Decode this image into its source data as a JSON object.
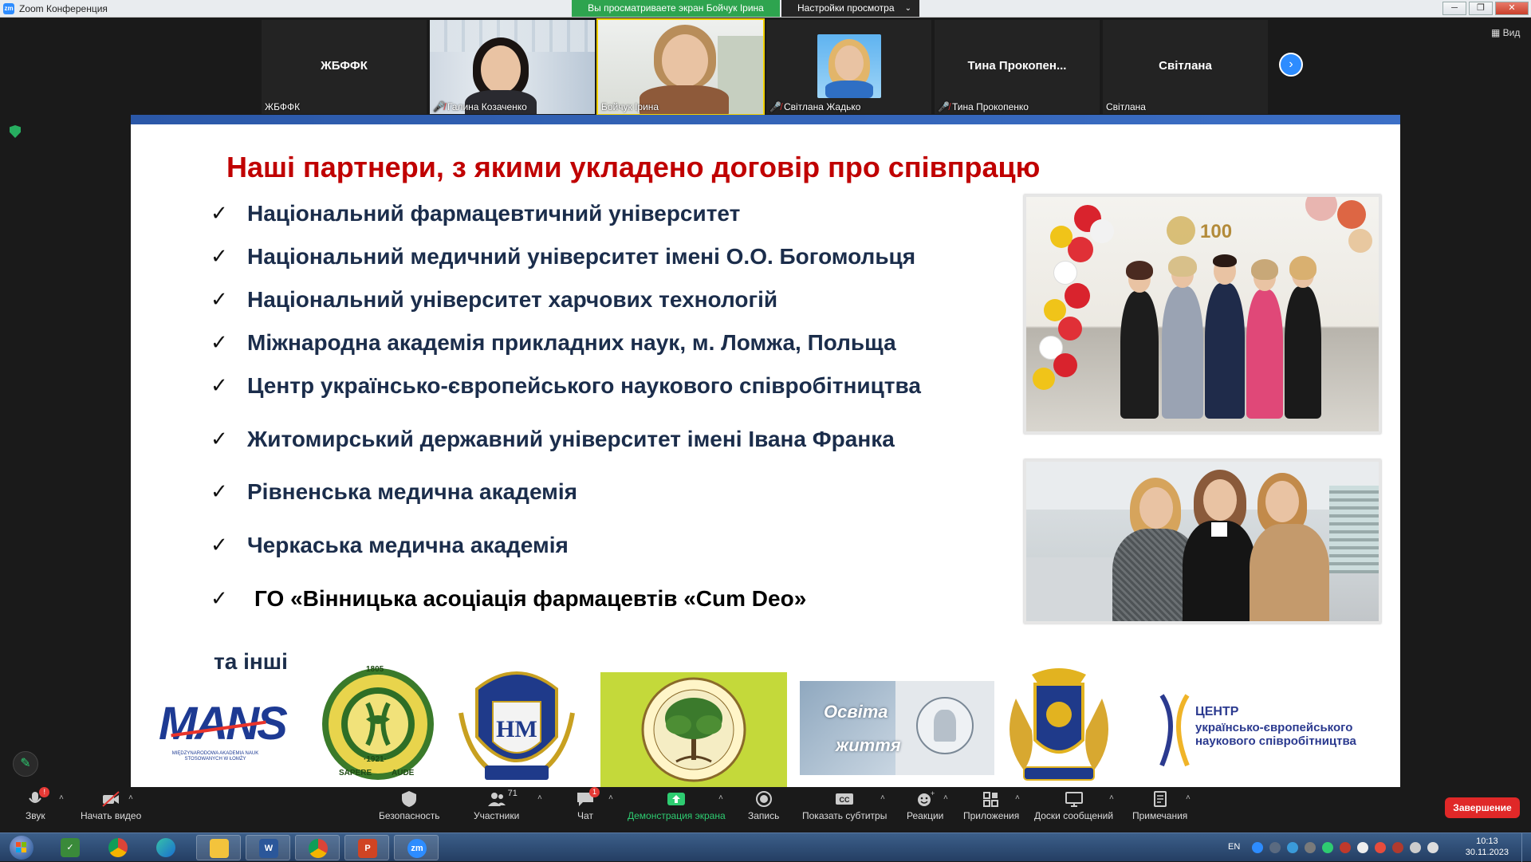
{
  "window": {
    "title": "Zoom Конференция",
    "viewing_banner": "Вы просматриваете экран Бойчук Ірина",
    "view_settings": "Настройки просмотра",
    "controls": [
      "─",
      "❐",
      "✕"
    ]
  },
  "gallery": {
    "view_label": "Вид",
    "tiles": [
      {
        "center_name": "ЖБФФК",
        "tag": "ЖБФФК",
        "muted": false
      },
      {
        "center_name": "",
        "tag": "Галина Козаченко",
        "muted": true
      },
      {
        "center_name": "",
        "tag": "Бойчук Ірина",
        "muted": false
      },
      {
        "center_name": "",
        "tag": "Світлана Жадько",
        "muted": true
      },
      {
        "center_name": "Тина  Прокопен...",
        "tag": "Тина Прокопенко",
        "muted": true
      },
      {
        "center_name": "Світлана",
        "tag": "Світлана",
        "muted": false
      }
    ]
  },
  "slide": {
    "title": "Наші партнери, з якими укладено договір про співпрацю",
    "check": "✓",
    "partners": [
      "Національний фармацевтичний університет",
      "Національний медичний університет імені О.О. Богомольця",
      "Національний університет харчових технологій",
      "Міжнародна академія прикладних наук, м. Ломжа, Польща",
      "Центр українсько-європейського наукового співробітництва",
      "Житомирський державний університет імені Івана Франка",
      "Рівненська медична академія",
      "Черкаська медична академія",
      "ГО «Вінницька асоціація фармацевтів «Cum Deo»"
    ],
    "others": "та інші",
    "logos": {
      "mans_title": "MANS",
      "mans_sub": "MIĘDZYNARODOWA AKADEMIA NAUK STOSOWANYCH W ŁOMŻY",
      "nfu_top": "1805",
      "nfu_year": "·1921·",
      "nfu_motto_left": "SAPERE",
      "nfu_motto_right": "AUDE",
      "osvita_1": "Освіта",
      "osvita_2": "життя",
      "centr_title": "ЦЕНТР",
      "centr_sub_1": "українсько-європейського",
      "centr_sub_2": "наукового співробітництва"
    }
  },
  "toolbar": {
    "items": [
      {
        "label": "Звук",
        "badge": "!"
      },
      {
        "label": "Начать видео"
      },
      {
        "label": "Безопасность"
      },
      {
        "label": "Участники",
        "count": "71"
      },
      {
        "label": "Чат",
        "badge": "1"
      },
      {
        "label": "Демонстрация экрана"
      },
      {
        "label": "Запись"
      },
      {
        "label": "Показать субтитры"
      },
      {
        "label": "Реакции"
      },
      {
        "label": "Приложения"
      },
      {
        "label": "Доски сообщений"
      },
      {
        "label": "Примечания"
      }
    ],
    "end_label": "Завершение"
  },
  "taskbar": {
    "apps": [
      "W",
      "P",
      "zm"
    ],
    "lang": "EN",
    "time": "10:13",
    "date": "30.11.2023"
  },
  "colors": {
    "accent": "#2d8cff",
    "title_red": "#c00000",
    "text_navy": "#1b2d4b",
    "viewing_green": "#2ea44f",
    "end_red": "#e02828"
  }
}
